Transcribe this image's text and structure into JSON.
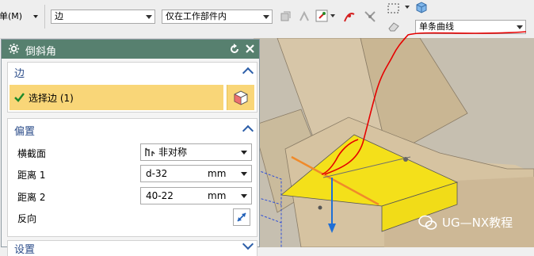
{
  "toolbar": {
    "menu_label": "菜单(M)",
    "filter_type": "边",
    "filter_scope": "仅在工作部件内",
    "curve_rule": "单条曲线"
  },
  "dialog": {
    "title": "倒斜角",
    "section_edge": {
      "header": "边",
      "select_label": "选择边 (1)"
    },
    "section_offset": {
      "header": "偏置",
      "cross_section_label": "横截面",
      "cross_section_value": "非对称",
      "distance1_label": "距离 1",
      "distance1_value": "d-32",
      "distance1_unit": "mm",
      "distance2_label": "距离 2",
      "distance2_value": "40-22",
      "distance2_unit": "mm",
      "reverse_label": "反向"
    },
    "section_settings": {
      "header": "设置"
    }
  },
  "viewport": {
    "watermark": "UG—NX教程"
  },
  "colors": {
    "dialog_title_bg": "#57806f",
    "selected_row_bg": "#f9d678",
    "chamfer_face": "#f4e01a",
    "part_tan": "#d8c39f",
    "annotation_red": "#e60000",
    "axis_blue": "#1e6fd6",
    "edge_orange": "#f08a2a"
  }
}
